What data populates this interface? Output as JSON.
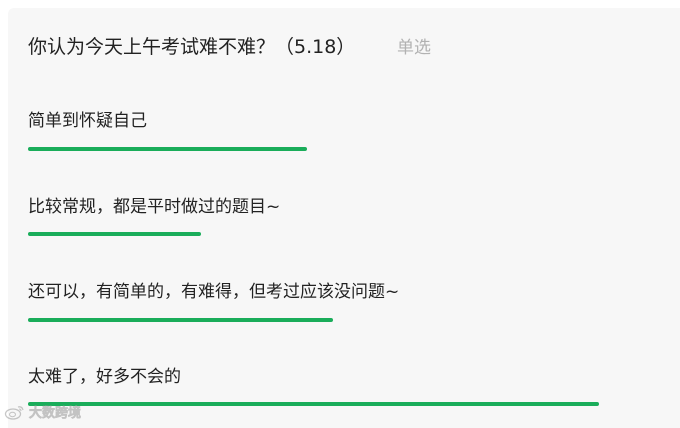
{
  "survey": {
    "question": "你认为今天上午考试难不难？（5.18）",
    "type_label": "单选",
    "options": [
      {
        "label": "简单到怀疑自己",
        "share": 0.49
      },
      {
        "label": "比较常规，都是平时做过的题目~",
        "share": 0.3
      },
      {
        "label": "还可以，有简单的，有难得，但考过应该没问题~",
        "share": 0.54
      },
      {
        "label": "太难了，好多不会的",
        "share": 1.0
      }
    ],
    "bar_color": "#1aad5a"
  },
  "watermark": {
    "text": "大数跨境",
    "icon": "weibo-logo-icon"
  }
}
